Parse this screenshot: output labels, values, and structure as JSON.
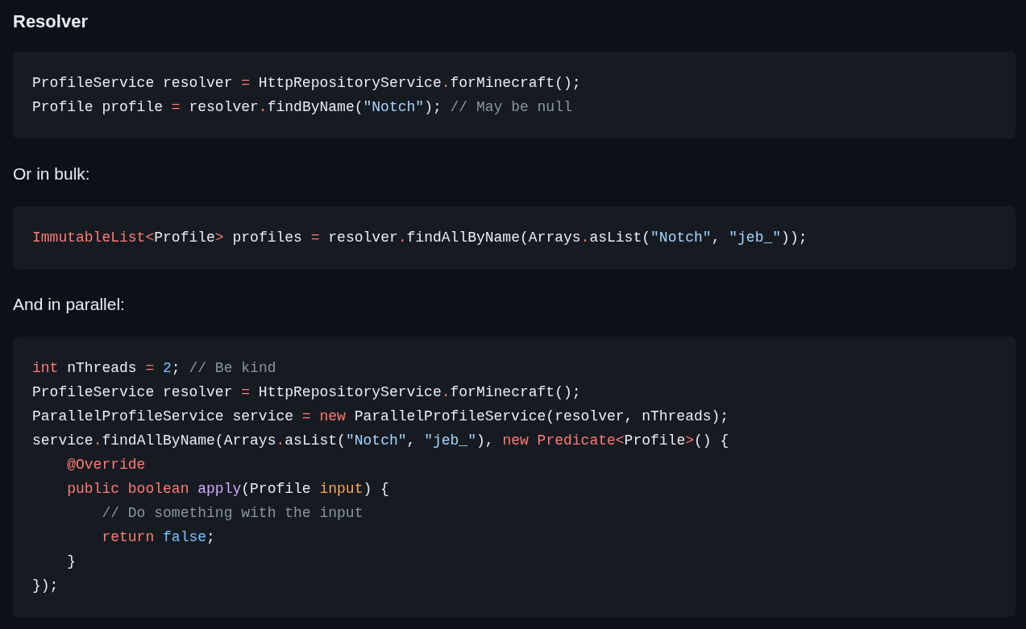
{
  "blocks": [
    {
      "kind": "heading",
      "text": "Resolver"
    },
    {
      "kind": "code",
      "lines": [
        [
          {
            "text": "ProfileService resolver ",
            "kind": "plain"
          },
          {
            "text": "=",
            "kind": "op"
          },
          {
            "text": " HttpRepositoryService",
            "kind": "plain"
          },
          {
            "text": ".",
            "kind": "op"
          },
          {
            "text": "forMinecraft();",
            "kind": "plain"
          }
        ],
        [
          {
            "text": "Profile profile ",
            "kind": "plain"
          },
          {
            "text": "=",
            "kind": "op"
          },
          {
            "text": " resolver",
            "kind": "plain"
          },
          {
            "text": ".",
            "kind": "op"
          },
          {
            "text": "findByName(",
            "kind": "plain"
          },
          {
            "text": "\"Notch\"",
            "kind": "string"
          },
          {
            "text": "); ",
            "kind": "plain"
          },
          {
            "text": "// May be null",
            "kind": "comment"
          }
        ]
      ]
    },
    {
      "kind": "paragraph",
      "text": "Or in bulk:"
    },
    {
      "kind": "code",
      "lines": [
        [
          {
            "text": "ImmutableList<",
            "kind": "keyword"
          },
          {
            "text": "Profile",
            "kind": "plain"
          },
          {
            "text": ">",
            "kind": "keyword"
          },
          {
            "text": " profiles ",
            "kind": "plain"
          },
          {
            "text": "=",
            "kind": "op"
          },
          {
            "text": " resolver",
            "kind": "plain"
          },
          {
            "text": ".",
            "kind": "op"
          },
          {
            "text": "findAllByName(Arrays",
            "kind": "plain"
          },
          {
            "text": ".",
            "kind": "op"
          },
          {
            "text": "asList(",
            "kind": "plain"
          },
          {
            "text": "\"Notch\"",
            "kind": "string"
          },
          {
            "text": ", ",
            "kind": "plain"
          },
          {
            "text": "\"jeb_\"",
            "kind": "string"
          },
          {
            "text": "));",
            "kind": "plain"
          }
        ]
      ]
    },
    {
      "kind": "paragraph",
      "text": "And in parallel:"
    },
    {
      "kind": "code",
      "lines": [
        [
          {
            "text": "int",
            "kind": "keyword"
          },
          {
            "text": " nThreads ",
            "kind": "plain"
          },
          {
            "text": "=",
            "kind": "op"
          },
          {
            "text": " 2",
            "kind": "number"
          },
          {
            "text": "; ",
            "kind": "plain"
          },
          {
            "text": "// Be kind",
            "kind": "comment"
          }
        ],
        [
          {
            "text": "ProfileService resolver ",
            "kind": "plain"
          },
          {
            "text": "=",
            "kind": "op"
          },
          {
            "text": " HttpRepositoryService",
            "kind": "plain"
          },
          {
            "text": ".",
            "kind": "op"
          },
          {
            "text": "forMinecraft();",
            "kind": "plain"
          }
        ],
        [
          {
            "text": "ParallelProfileService service ",
            "kind": "plain"
          },
          {
            "text": "=",
            "kind": "op"
          },
          {
            "text": " new",
            "kind": "keyword"
          },
          {
            "text": " ParallelProfileService(resolver, nThreads);",
            "kind": "plain"
          }
        ],
        [
          {
            "text": "service",
            "kind": "plain"
          },
          {
            "text": ".",
            "kind": "op"
          },
          {
            "text": "findAllByName(Arrays",
            "kind": "plain"
          },
          {
            "text": ".",
            "kind": "op"
          },
          {
            "text": "asList(",
            "kind": "plain"
          },
          {
            "text": "\"Notch\"",
            "kind": "string"
          },
          {
            "text": ", ",
            "kind": "plain"
          },
          {
            "text": "\"jeb_\"",
            "kind": "string"
          },
          {
            "text": "), ",
            "kind": "plain"
          },
          {
            "text": "new Predicate<",
            "kind": "keyword"
          },
          {
            "text": "Profile",
            "kind": "plain"
          },
          {
            "text": ">",
            "kind": "keyword"
          },
          {
            "text": "() {",
            "kind": "plain"
          }
        ],
        [
          {
            "text": "    @Override",
            "kind": "keyword"
          }
        ],
        [
          {
            "text": "    public boolean ",
            "kind": "keyword"
          },
          {
            "text": "apply",
            "kind": "function"
          },
          {
            "text": "(Profile ",
            "kind": "plain"
          },
          {
            "text": "input",
            "kind": "param"
          },
          {
            "text": ") {",
            "kind": "plain"
          }
        ],
        [
          {
            "text": "        // Do something with the input",
            "kind": "comment"
          }
        ],
        [
          {
            "text": "        return ",
            "kind": "keyword"
          },
          {
            "text": "false",
            "kind": "number"
          },
          {
            "text": ";",
            "kind": "plain"
          }
        ],
        [
          {
            "text": "    }",
            "kind": "plain"
          }
        ],
        [
          {
            "text": "});",
            "kind": "plain"
          }
        ]
      ]
    }
  ]
}
